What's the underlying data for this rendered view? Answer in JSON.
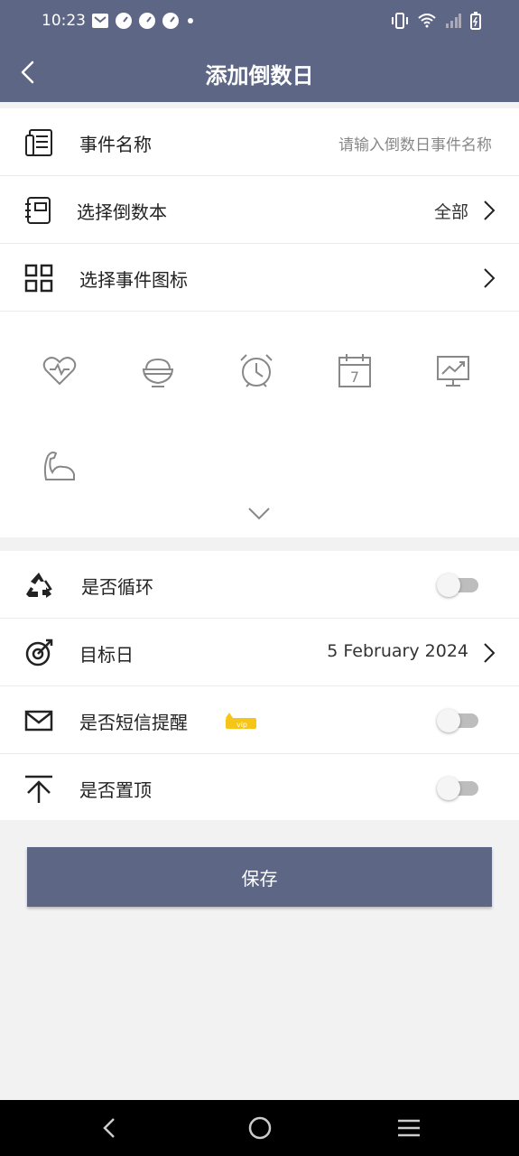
{
  "status_bar": {
    "time": "10:23",
    "left_icons": [
      "gmail-icon",
      "speed-icon",
      "speed-icon",
      "speed-icon",
      "dot-icon"
    ],
    "right_icons": [
      "vibrate-icon",
      "wifi-icon",
      "signal-icon",
      "battery-icon"
    ]
  },
  "header": {
    "title": "添加倒数日",
    "back_icon": "back-arrow-icon"
  },
  "form": {
    "event_name": {
      "label": "事件名称",
      "placeholder": "请输入倒数日事件名称",
      "icon": "document-icon"
    },
    "countdown_book": {
      "label": "选择倒数本",
      "value": "全部",
      "icon": "notebook-icon"
    },
    "event_icon": {
      "label": "选择事件图标",
      "icon": "grid-icon"
    }
  },
  "icon_choices": [
    "heart-icon",
    "bowl-icon",
    "alarm-clock-icon",
    "calendar-7-icon",
    "chart-monitor-icon",
    "muscle-arm-icon"
  ],
  "options": {
    "repeat": {
      "label": "是否循环",
      "icon": "recycle-icon",
      "enabled": false
    },
    "target_date": {
      "label": "目标日",
      "value": "5 February 2024",
      "icon": "target-icon"
    },
    "sms_reminder": {
      "label": "是否短信提醒",
      "icon": "envelope-icon",
      "badge": "vip",
      "enabled": false
    },
    "pin_top": {
      "label": "是否置顶",
      "icon": "pin-top-icon",
      "enabled": false
    }
  },
  "save_label": "保存",
  "colors": {
    "primary": "#5d6785",
    "background": "#f2f2f2"
  },
  "nav_bar": [
    "nav-back-icon",
    "nav-home-icon",
    "nav-menu-icon"
  ]
}
